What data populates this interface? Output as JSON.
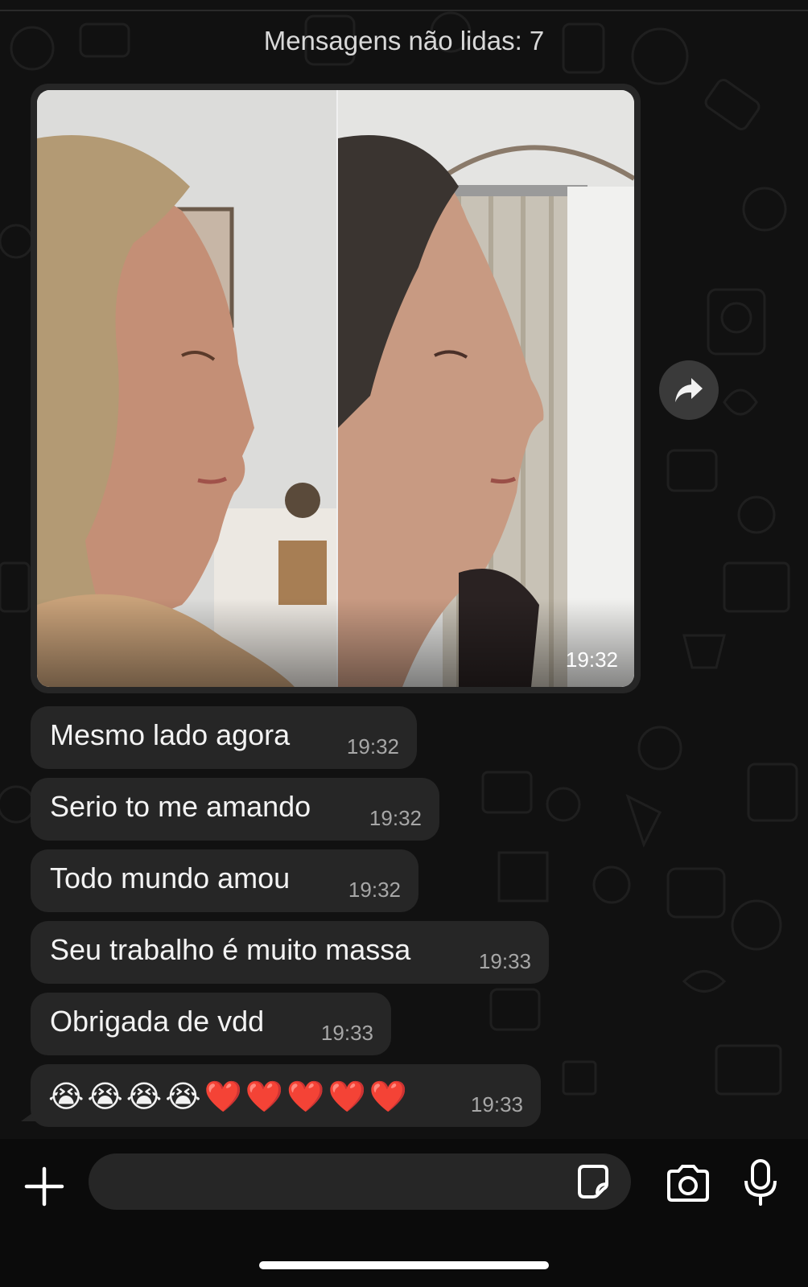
{
  "unread_banner": "Mensagens não lidas: 7",
  "image_message": {
    "time": "19:32"
  },
  "messages": [
    {
      "text": "Mesmo lado agora",
      "time": "19:32"
    },
    {
      "text": "Serio to me amando",
      "time": "19:32"
    },
    {
      "text": "Todo mundo amou",
      "time": "19:32"
    },
    {
      "text": "Seu trabalho é muito massa",
      "time": "19:33"
    },
    {
      "text": "Obrigada de vdd",
      "time": "19:33"
    },
    {
      "text": "😭😭😭😭❤️❤️❤️❤️❤️",
      "time": "19:33"
    }
  ],
  "icons": {
    "forward": "forward-arrow-icon",
    "attach": "plus-icon",
    "sticker": "sticker-icon",
    "camera": "camera-icon",
    "mic": "microphone-icon"
  },
  "colors": {
    "background": "#111111",
    "bubble": "#262626",
    "text": "#f3f3f3",
    "timestamp": "#a7a7a7"
  }
}
